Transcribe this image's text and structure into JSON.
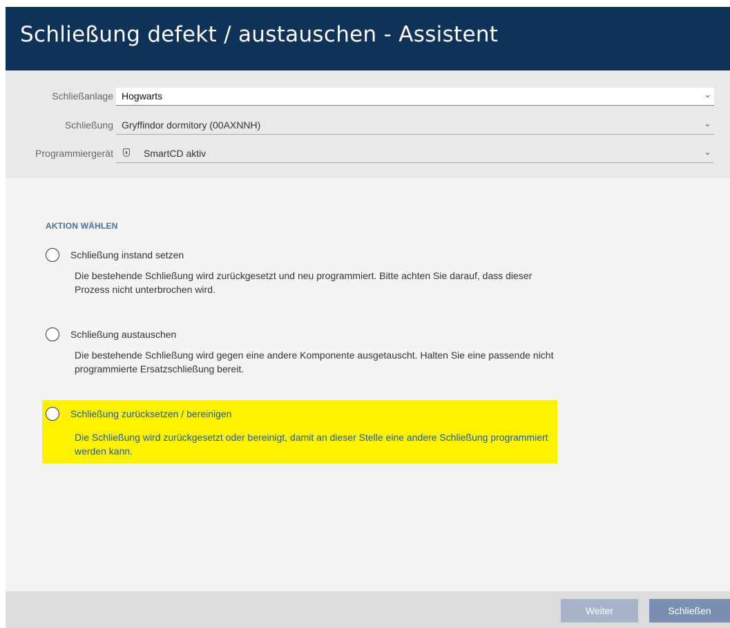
{
  "window": {
    "title": "Schließung defekt / austauschen - Assistent"
  },
  "form": {
    "schliessanlage": {
      "label": "Schließanlage",
      "value": "Hogwarts"
    },
    "schliessung": {
      "label": "Schließung",
      "value": "Gryffindor dormitory (00AXNNH)"
    },
    "programmiergeraet": {
      "label": "Programmiergerät",
      "value": "SmartCD aktiv",
      "icon": "device-icon"
    }
  },
  "action": {
    "title": "AKTION WÄHLEN",
    "options": [
      {
        "label": "Schließung instand setzen",
        "description": "Die bestehende Schließung wird zurückgesetzt und neu programmiert. Bitte achten Sie darauf, dass dieser Prozess nicht unterbrochen wird.",
        "selected": false
      },
      {
        "label": "Schließung austauschen",
        "description": "Die bestehende Schließung wird gegen eine andere Komponente ausgetauscht. Halten Sie eine passende nicht programmierte Ersatzschließung bereit.",
        "selected": false
      },
      {
        "label": "Schließung zurücksetzen / bereinigen",
        "description": "Die Schließung wird zurückgesetzt oder bereinigt, damit an dieser Stelle eine andere Schließung programmiert werden kann.",
        "selected": false,
        "highlight_color": "#fff200"
      }
    ]
  },
  "footer": {
    "next_label": "Weiter",
    "close_label": "Schließen"
  },
  "colors": {
    "titlebar": "#0f3358",
    "accent": "#4a6e96",
    "button_disabled": "#a7b4c9",
    "button": "#7a8fb1"
  }
}
